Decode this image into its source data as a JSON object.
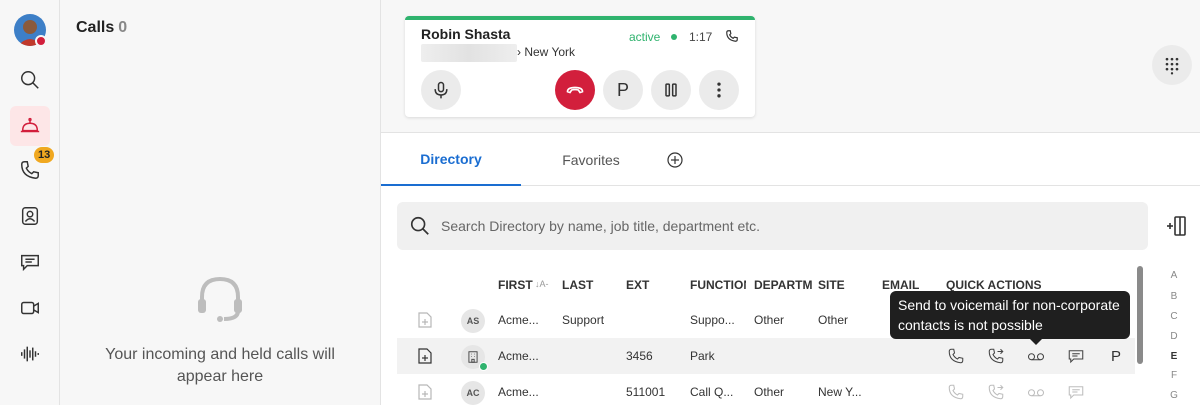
{
  "rail": {
    "avatar_initials": "",
    "badge_count": "13",
    "items": [
      "search",
      "calls-active",
      "calls-history",
      "contacts",
      "messaging",
      "meetings",
      "voicemail"
    ]
  },
  "calls_panel": {
    "title": "Calls",
    "count": "0",
    "empty_text": "Your incoming and held calls will appear here"
  },
  "active_call": {
    "name": "Robin Shasta",
    "location": "New York",
    "status": "active",
    "timer": "1:17",
    "park_label": "P"
  },
  "tabs": [
    {
      "label": "Directory",
      "active": true
    },
    {
      "label": "Favorites",
      "active": false
    }
  ],
  "search": {
    "placeholder": "Search Directory by name, job title, department etc."
  },
  "table": {
    "headers": {
      "first": "FIRST",
      "sort": "↓A-",
      "last": "LAST",
      "ext": "EXT",
      "function": "FUNCTION",
      "department": "DEPARTMENT",
      "site": "SITE",
      "email": "EMAIL",
      "quick_actions": "QUICK ACTIONS"
    },
    "rows": [
      {
        "avatar": "AS",
        "first": "Acme...",
        "last": "Support",
        "ext": "",
        "function": "Suppo...",
        "department": "Other",
        "site": "Other",
        "online": false
      },
      {
        "avatar": "",
        "first": "Acme...",
        "last": "",
        "ext": "3456",
        "function": "Park",
        "department": "",
        "site": "",
        "online": true
      },
      {
        "avatar": "AC",
        "first": "Acme...",
        "last": "",
        "ext": "511001",
        "function": "Call Q...",
        "department": "Other",
        "site": "New Y...",
        "online": false
      }
    ],
    "park_label": "P"
  },
  "tooltip": {
    "text": "Send to voicemail for non-corporate contacts is not possible"
  },
  "alphabet": [
    "A",
    "B",
    "C",
    "D",
    "E",
    "F",
    "G"
  ],
  "alphabet_current": "E",
  "colors": {
    "accent": "#1a6dd1",
    "end_call": "#d21f3c",
    "active_green": "#2fb36e",
    "badge": "#f0a820"
  }
}
